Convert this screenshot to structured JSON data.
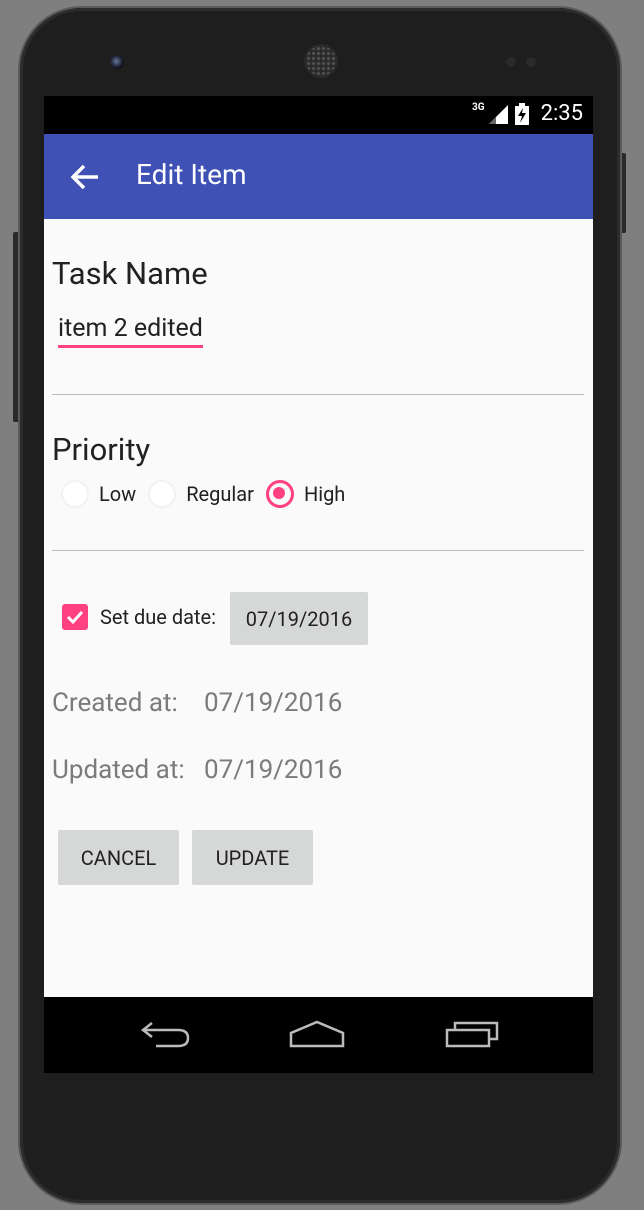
{
  "status_bar": {
    "network": "3G",
    "time": "2:35"
  },
  "toolbar": {
    "title": "Edit Item",
    "back_icon": "arrow-back-icon"
  },
  "task": {
    "label": "Task Name",
    "value": "item 2 edited"
  },
  "priority": {
    "label": "Priority",
    "options": [
      {
        "label": "Low",
        "selected": false
      },
      {
        "label": "Regular",
        "selected": false
      },
      {
        "label": "High",
        "selected": true
      }
    ]
  },
  "due": {
    "checkbox_label": "Set due date:",
    "checked": true,
    "date": "07/19/2016"
  },
  "meta": {
    "created_label": "Created at:",
    "created_value": "07/19/2016",
    "updated_label": "Updated at:",
    "updated_value": "07/19/2016"
  },
  "actions": {
    "cancel": "CANCEL",
    "update": "UPDATE"
  },
  "colors": {
    "primary": "#3f51b5",
    "accent": "#ff4081",
    "button_bg": "#d6d7d7"
  }
}
